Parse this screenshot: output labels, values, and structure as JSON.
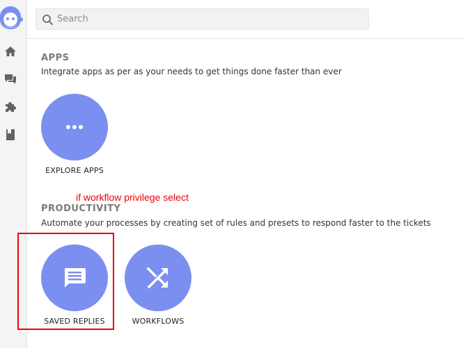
{
  "search": {
    "placeholder": "Search"
  },
  "sidebar": {
    "items": [
      {
        "icon": "home-icon"
      },
      {
        "icon": "chat-icon"
      },
      {
        "icon": "puzzle-icon"
      },
      {
        "icon": "book-icon"
      }
    ]
  },
  "apps_section": {
    "title": "APPS",
    "description": "Integrate apps as per as your needs to get things done faster than ever",
    "tiles": [
      {
        "label": "EXPLORE APPS",
        "icon": "more-dots-icon"
      }
    ]
  },
  "annotation": {
    "text": "if workflow privilege select"
  },
  "productivity_section": {
    "title": "PRODUCTIVITY",
    "description": "Automate your processes by creating set of rules and presets to respond faster to the tickets",
    "tiles": [
      {
        "label": "SAVED REPLIES",
        "icon": "message-icon"
      },
      {
        "label": "WORKFLOWS",
        "icon": "shuffle-icon"
      }
    ]
  },
  "colors": {
    "tile_circle": "#7b8ff0",
    "annotation": "#e8000b",
    "logo": "#7b8ff0"
  }
}
